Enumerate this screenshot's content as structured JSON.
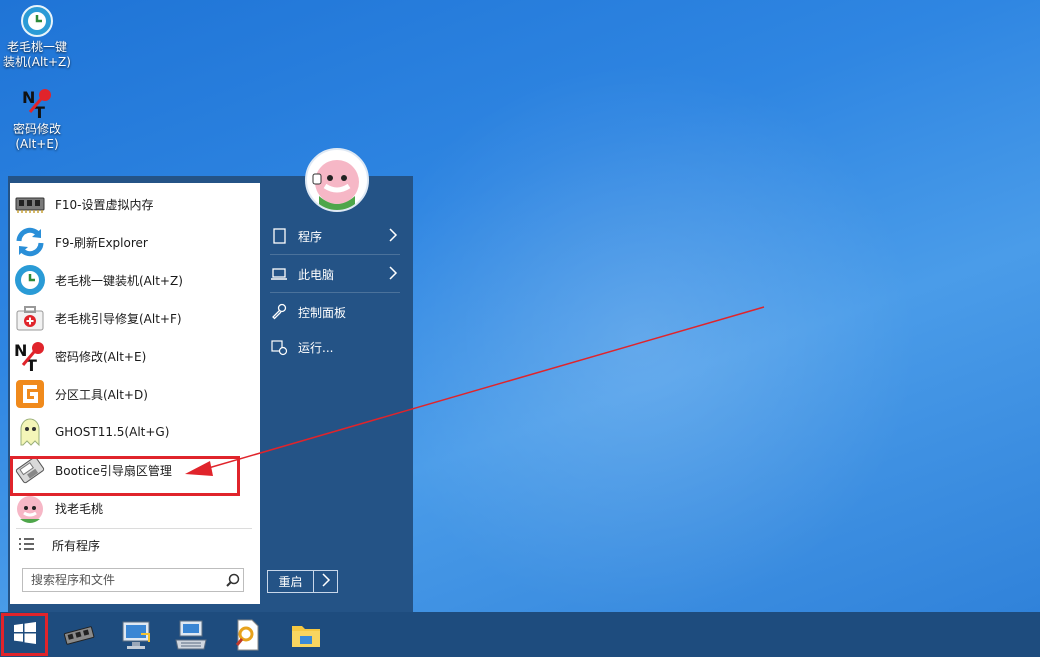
{
  "desktop": {
    "icons": [
      {
        "label": "老毛桃一键\n装机(Alt+Z)",
        "icon": "laomaotao-install-icon"
      },
      {
        "label": "密码修改\n(Alt+E)",
        "icon": "nt-password-icon"
      }
    ]
  },
  "start_menu": {
    "items": [
      {
        "label": "F10-设置虚拟内存",
        "icon": "memory-chip-icon"
      },
      {
        "label": "F9-刷新Explorer",
        "icon": "refresh-icon"
      },
      {
        "label": "老毛桃一键装机(Alt+Z)",
        "icon": "laomaotao-install-icon"
      },
      {
        "label": "老毛桃引导修复(Alt+F)",
        "icon": "first-aid-kit-icon"
      },
      {
        "label": "密码修改(Alt+E)",
        "icon": "nt-password-icon"
      },
      {
        "label": "分区工具(Alt+D)",
        "icon": "diskgenius-icon"
      },
      {
        "label": "GHOST11.5(Alt+G)",
        "icon": "ghost-icon"
      },
      {
        "label": "Bootice引导扇区管理",
        "icon": "bootice-icon"
      },
      {
        "label": "找老毛桃",
        "icon": "peach-mascot-icon"
      }
    ],
    "all_programs": "所有程序",
    "search_placeholder": "搜索程序和文件",
    "right": {
      "programs": "程序",
      "this_pc": "此电脑",
      "control_panel": "控制面板",
      "run": "运行..."
    },
    "restart": "重启"
  },
  "colors": {
    "desktop": "#2f86e2",
    "start_panel": "#245386",
    "taskbar": "#1e4c7e",
    "annotation_red": "#e0242b"
  }
}
